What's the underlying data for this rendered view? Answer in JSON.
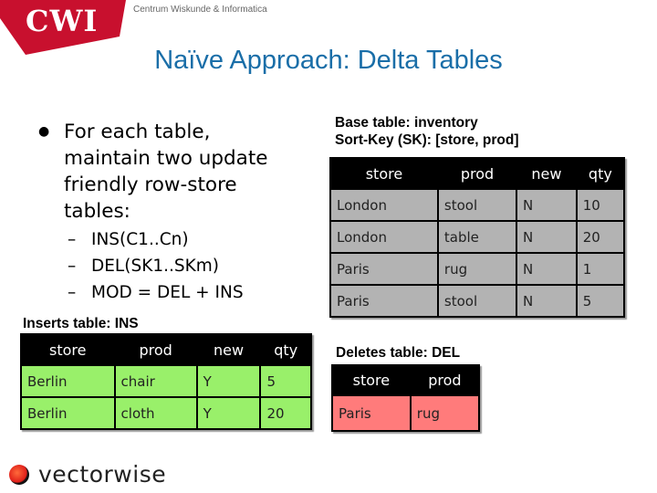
{
  "header": {
    "logo_text": "CWI",
    "logo_color": "#c8102e",
    "subtitle": "Centrum Wiskunde & Informatica"
  },
  "title": "Naïve Approach: Delta Tables",
  "bullets": {
    "main": [
      "For each table,",
      "maintain two update",
      "friendly row-store",
      "tables:"
    ],
    "sub": [
      "INS(C1..Cn)",
      "DEL(SK1..SKm)",
      "MOD = DEL + INS"
    ],
    "dash": "–",
    "dot": "●"
  },
  "base_table": {
    "caption_line1": "Base table: inventory",
    "caption_line2": "Sort-Key (SK): [store, prod]",
    "headers": [
      "store",
      "prod",
      "new",
      "qty"
    ],
    "rows": [
      [
        "London",
        "stool",
        "N",
        "10"
      ],
      [
        "London",
        "table",
        "N",
        "20"
      ],
      [
        "Paris",
        "rug",
        "N",
        "1"
      ],
      [
        "Paris",
        "stool",
        "N",
        "5"
      ]
    ],
    "cell_color": "#b3b3b3"
  },
  "ins_table": {
    "caption": "Inserts table: INS",
    "headers": [
      "store",
      "prod",
      "new",
      "qty"
    ],
    "rows": [
      [
        "Berlin",
        "chair",
        "Y",
        "5"
      ],
      [
        "Berlin",
        "cloth",
        "Y",
        "20"
      ]
    ],
    "cell_color": "#99f06a"
  },
  "del_table": {
    "caption": "Deletes table: DEL",
    "headers": [
      "store",
      "prod"
    ],
    "rows": [
      [
        "Paris",
        "rug"
      ]
    ],
    "cell_color": "#ff7b7b"
  },
  "footer": {
    "logo_text": "vectorwise"
  }
}
